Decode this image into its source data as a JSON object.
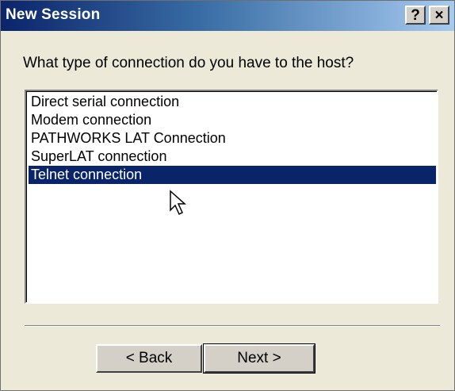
{
  "window": {
    "title": "New Session",
    "help_label": "?",
    "close_label": "×"
  },
  "prompt": "What type of connection do you have to the host?",
  "connections": {
    "items": [
      {
        "label": "Direct serial connection"
      },
      {
        "label": "Modem connection"
      },
      {
        "label": "PATHWORKS LAT Connection"
      },
      {
        "label": "SuperLAT connection"
      },
      {
        "label": "Telnet connection"
      }
    ],
    "selected_index": 4
  },
  "buttons": {
    "back_label": "< Back",
    "next_label": "Next >"
  },
  "colors": {
    "selection": "#0a246a",
    "titlebar_start": "#0b246a",
    "titlebar_end": "#a6caf0",
    "face": "#ece9d8"
  },
  "icons": {
    "cursor": "mouse-pointer-icon"
  }
}
